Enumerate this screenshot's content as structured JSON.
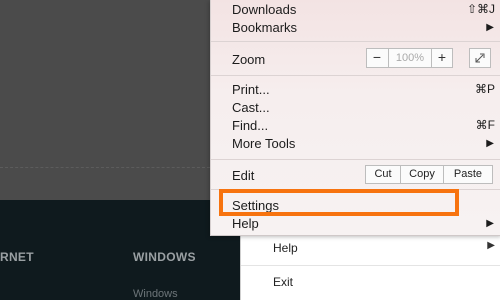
{
  "background": {
    "headings": [
      "RNET",
      "WINDOWS"
    ],
    "sublinks": [
      "Windows"
    ]
  },
  "submenu": {
    "items": [
      {
        "label": "Help",
        "arrow": "▶"
      },
      {
        "label": "Exit"
      }
    ]
  },
  "menu": {
    "downloads": {
      "label": "Downloads",
      "shortcut": "⇧⌘J"
    },
    "bookmarks": {
      "label": "Bookmarks",
      "arrow": "▶"
    },
    "zoom": {
      "label": "Zoom",
      "minus": "−",
      "value": "100%",
      "plus": "+",
      "fullscreen_icon": "fullscreen-icon"
    },
    "print": {
      "label": "Print...",
      "shortcut": "⌘P"
    },
    "cast": {
      "label": "Cast..."
    },
    "find": {
      "label": "Find...",
      "shortcut": "⌘F"
    },
    "more_tools": {
      "label": "More Tools",
      "arrow": "▶"
    },
    "edit": {
      "label": "Edit",
      "cut": "Cut",
      "copy": "Copy",
      "paste": "Paste"
    },
    "settings": {
      "label": "Settings"
    },
    "help": {
      "label": "Help",
      "arrow": "▶"
    }
  },
  "colors": {
    "highlight": "#f7730f",
    "menu_bg": "#f5eaea",
    "page_dark": "#0f1a1e"
  }
}
